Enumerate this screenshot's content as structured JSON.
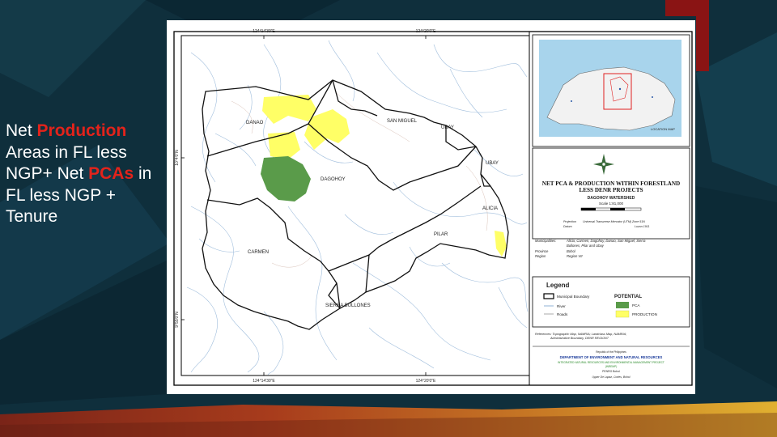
{
  "slide": {
    "line1_prefix": "Net ",
    "line1_highlight": "Production",
    "line2": "Areas in FL less",
    "line3_prefix": "NGP+ Net ",
    "line3_highlight": "PCAs",
    "line3_suffix": " in",
    "line4": "FL less NGP +",
    "line5": "Tenure"
  },
  "colors": {
    "background": "#0f2f3c",
    "highlight_text": "#e3231b",
    "pca": "#5a9b4a",
    "production": "#ffff66",
    "bottom_band": "#d4a030"
  },
  "map": {
    "coord_top_left": "124°14'30\"E",
    "coord_top_right": "124°20'0\"E",
    "coord_bottom_left": "124°14'30\"E",
    "coord_bottom_right": "124°20'0\"E",
    "coord_left_top": "10°4'0\"N",
    "coord_left_bottom": "9°55'0\"N",
    "municipalities": {
      "danao": "DANAO",
      "san_miguel": "SAN MIGUEL",
      "ubay_top": "UBAY",
      "ubay_right": "UBAY",
      "dagohoy": "DAGOHOY",
      "alicia": "ALICIA",
      "pilar": "PILAR",
      "carmen": "CARMEN",
      "sierra_bullones": "SIERRA BULLONES"
    }
  },
  "title_block": {
    "line1": "NET PCA & PRODUCTION WITHIN FORESTLAND",
    "line2": "LESS DENR PROJECTS",
    "watershed": "DAGOHOY WATERSHED",
    "scale": "Scale 1:81,000",
    "projection_label": "Projection",
    "projection_value": "Universal Transverse Mercator (UTM) Zone 51N",
    "datum_label": "Datum",
    "datum_value": "Luzon 1911"
  },
  "info": {
    "municipalities_label": "Municipalities:",
    "municipalities_value1": "Alicia, Carmen, Dagohoy, Danao, San Miguel, Sierra",
    "municipalities_value2": "Bullones, Pilar and Ubay",
    "province_label": "Province",
    "province_value": "Bohol",
    "region_label": "Region",
    "region_value": "Region VII"
  },
  "legend": {
    "title": "Legend",
    "municipal_boundary": "Municipal Boundary",
    "river": "River",
    "roads": "Roads",
    "potential_title": "POTENTIAL",
    "pca": "PCA",
    "production": "PRODUCTION"
  },
  "references": {
    "line1": "References: Topographic Map, NAMRIA; Landclass Map, NAMRIA;",
    "line2": "Administrative Boundary, DENR REGION7"
  },
  "agency": {
    "republic": "Republic of the Philippines",
    "department": "DEPARTMENT OF ENVIRONMENT AND NATURAL RESOURCES",
    "project1": "INTEGRATED NATURAL RESOURCES AND ENVIRONMENTAL MANAGEMENT PROJECT",
    "project2": "(INREMP)",
    "penro": "PENRO Bohol",
    "address": "Upper De Lapaz, Cortes, Bohol"
  },
  "location_map": {
    "label": "LOCATION MAP"
  }
}
